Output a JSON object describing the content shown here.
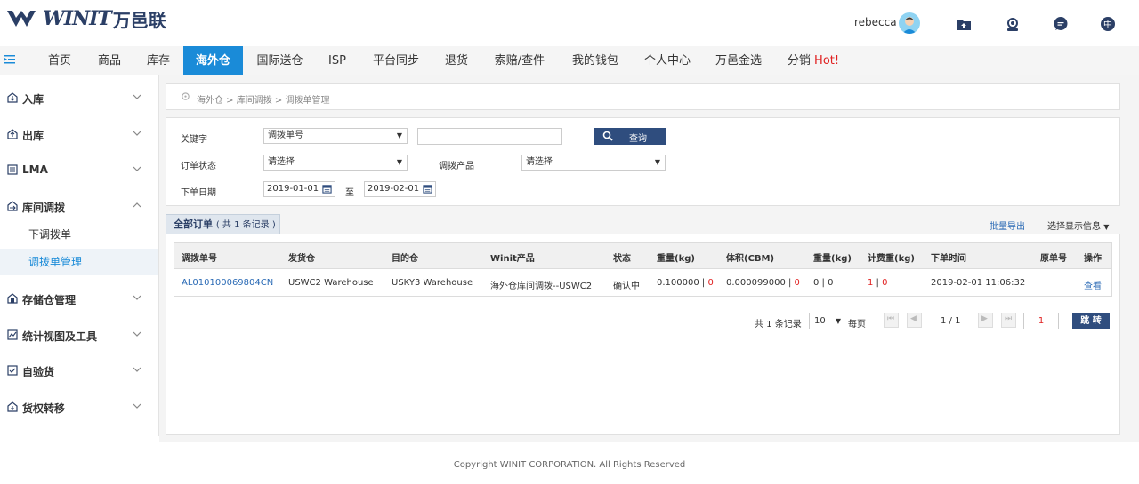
{
  "header": {
    "logo_text": "WINIT",
    "logo_cn": "万邑联",
    "username": "rebecca"
  },
  "nav": {
    "items": [
      "首页",
      "商品",
      "库存",
      "海外仓",
      "国际送仓",
      "ISP",
      "平台同步",
      "退货",
      "索赔/查件",
      "我的钱包",
      "个人中心",
      "万邑金选",
      "分销"
    ],
    "hot": "Hot!",
    "active": "海外仓"
  },
  "sidebar": {
    "items": [
      "入库",
      "出库",
      "LMA",
      "库间调拨",
      "存储仓管理",
      "统计视图及工具",
      "自验货",
      "货权转移"
    ],
    "sub_items": [
      "下调拨单",
      "调拨单管理"
    ],
    "active_sub": "调拨单管理"
  },
  "breadcrumb": "海外仓 > 库间调拨 > 调拨单管理",
  "filter": {
    "keyword_label": "关键字",
    "keyword_type": "调拨单号",
    "keyword_value": "",
    "search_label": "查询",
    "status_label": "订单状态",
    "status_value": "请选择",
    "product_label": "调拨产品",
    "product_value": "请选择",
    "date_label": "下单日期",
    "date_from": "2019-01-01",
    "date_to_label": "至",
    "date_to": "2019-02-01"
  },
  "list": {
    "tab_label": "全部订单",
    "tab_count": "( 共 1 条记录 )",
    "export_label": "批量导出",
    "choose_cols_label": "选择显示信息",
    "columns": [
      "调拨单号",
      "发货仓",
      "目的仓",
      "Winit产品",
      "状态",
      "重量(kg)",
      "体积(CBM)",
      "重量(kg)",
      "计费重(kg)",
      "下单时间",
      "原单号",
      "操作"
    ],
    "rows": [
      {
        "order_no": "AL010100069804CN",
        "from_wh": "USWC2 Warehouse",
        "to_wh": "USKY3 Warehouse",
        "product": "海外仓库间调拨--USWC2",
        "status": "确认中",
        "weight_a": "0.100000",
        "weight_b": "0",
        "volume_a": "0.000099000",
        "volume_b": "0",
        "weight2_a": "0",
        "weight2_b": "0",
        "charge_a": "1",
        "charge_b": "0",
        "order_time": "2019-02-01 11:06:32",
        "orig_no": "",
        "action": "查看"
      }
    ]
  },
  "pagination": {
    "total_text": "共 1 条记录",
    "page_size": "10",
    "per_page": "每页",
    "page_info": "1 / 1",
    "page_input": "1",
    "jump_label": "跳 转"
  },
  "footer": "Copyright WINIT CORPORATION. All Rights Reserved",
  "colors": {
    "accent": "#1a8bd8",
    "button": "#2f4d7e",
    "red": "#e02020",
    "link": "#2a6ab5"
  }
}
